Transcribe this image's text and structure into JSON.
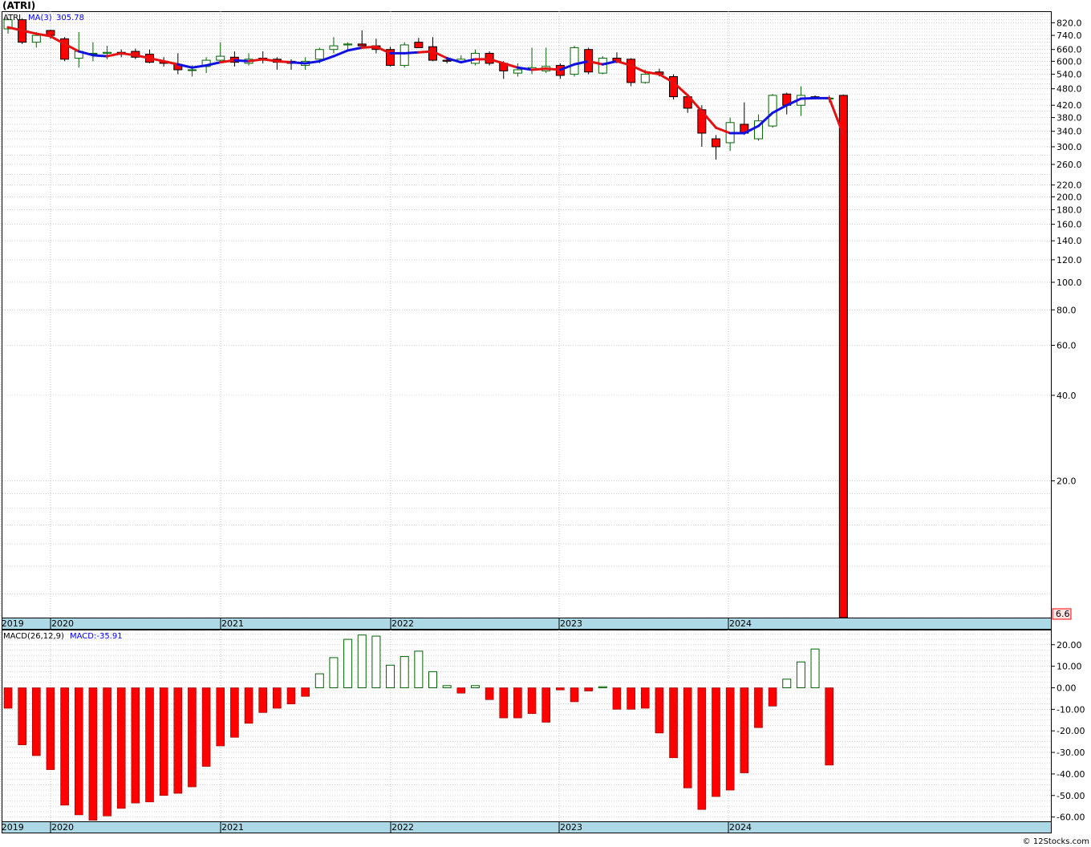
{
  "title": "(ATRI)",
  "copyright": "© 12Stocks.com",
  "colors": {
    "up": "#006400",
    "down": "#ff0000",
    "ma_down": "#e61010",
    "ma_up": "#1010e0",
    "axis_band": "#add8e6",
    "grid": "#b4b4b4",
    "last_price_bg": "#ffe4e1"
  },
  "chart_data": [
    {
      "type": "candlestick",
      "panel": "price",
      "legend": {
        "symbol": "ATRI",
        "ma_label": "MA(3)",
        "ma_value": "305.78"
      },
      "y_scale": "log",
      "ylim": [
        6.6,
        900
      ],
      "y_ticks": [
        "820.0",
        "740.0",
        "660.0",
        "600.0",
        "540.0",
        "480.0",
        "420.0",
        "380.0",
        "340.0",
        "300.0",
        "260.0",
        "220.0",
        "200.0",
        "180.0",
        "160.0",
        "140.0",
        "120.0",
        "100.0",
        "80.0",
        "60.0",
        "40.0",
        "20.0"
      ],
      "last_price": "6.6",
      "x_labels": [
        "2019",
        "2020",
        "2021",
        "2022",
        "2023",
        "2024"
      ],
      "candles": [
        {
          "o": 780,
          "h": 850,
          "l": 750,
          "c": 840
        },
        {
          "o": 840,
          "h": 850,
          "l": 690,
          "c": 700
        },
        {
          "o": 700,
          "h": 760,
          "l": 670,
          "c": 740
        },
        {
          "o": 770,
          "h": 775,
          "l": 720,
          "c": 740
        },
        {
          "o": 720,
          "h": 730,
          "l": 600,
          "c": 610
        },
        {
          "o": 615,
          "h": 760,
          "l": 570,
          "c": 650
        },
        {
          "o": 640,
          "h": 700,
          "l": 600,
          "c": 640
        },
        {
          "o": 640,
          "h": 680,
          "l": 610,
          "c": 645
        },
        {
          "o": 645,
          "h": 660,
          "l": 620,
          "c": 635
        },
        {
          "o": 650,
          "h": 665,
          "l": 610,
          "c": 620
        },
        {
          "o": 635,
          "h": 660,
          "l": 590,
          "c": 595
        },
        {
          "o": 600,
          "h": 620,
          "l": 575,
          "c": 590
        },
        {
          "o": 585,
          "h": 640,
          "l": 540,
          "c": 560
        },
        {
          "o": 560,
          "h": 580,
          "l": 530,
          "c": 560
        },
        {
          "o": 575,
          "h": 620,
          "l": 545,
          "c": 605
        },
        {
          "o": 605,
          "h": 700,
          "l": 590,
          "c": 625
        },
        {
          "o": 620,
          "h": 650,
          "l": 575,
          "c": 595
        },
        {
          "o": 590,
          "h": 640,
          "l": 580,
          "c": 610
        },
        {
          "o": 615,
          "h": 650,
          "l": 590,
          "c": 605
        },
        {
          "o": 610,
          "h": 620,
          "l": 560,
          "c": 595
        },
        {
          "o": 600,
          "h": 610,
          "l": 560,
          "c": 590
        },
        {
          "o": 580,
          "h": 620,
          "l": 560,
          "c": 600
        },
        {
          "o": 610,
          "h": 670,
          "l": 590,
          "c": 660
        },
        {
          "o": 660,
          "h": 730,
          "l": 640,
          "c": 680
        },
        {
          "o": 685,
          "h": 700,
          "l": 650,
          "c": 690
        },
        {
          "o": 690,
          "h": 770,
          "l": 680,
          "c": 680
        },
        {
          "o": 680,
          "h": 720,
          "l": 640,
          "c": 660
        },
        {
          "o": 660,
          "h": 675,
          "l": 575,
          "c": 580
        },
        {
          "o": 580,
          "h": 700,
          "l": 570,
          "c": 685
        },
        {
          "o": 700,
          "h": 725,
          "l": 690,
          "c": 670
        },
        {
          "o": 675,
          "h": 730,
          "l": 600,
          "c": 605
        },
        {
          "o": 605,
          "h": 620,
          "l": 590,
          "c": 600
        },
        {
          "o": 600,
          "h": 630,
          "l": 590,
          "c": 610
        },
        {
          "o": 590,
          "h": 660,
          "l": 580,
          "c": 640
        },
        {
          "o": 640,
          "h": 650,
          "l": 580,
          "c": 590
        },
        {
          "o": 590,
          "h": 600,
          "l": 520,
          "c": 555
        },
        {
          "o": 545,
          "h": 590,
          "l": 530,
          "c": 560
        },
        {
          "o": 560,
          "h": 670,
          "l": 540,
          "c": 570
        },
        {
          "o": 555,
          "h": 670,
          "l": 545,
          "c": 575
        },
        {
          "o": 580,
          "h": 590,
          "l": 520,
          "c": 535
        },
        {
          "o": 540,
          "h": 680,
          "l": 530,
          "c": 670
        },
        {
          "o": 660,
          "h": 670,
          "l": 540,
          "c": 550
        },
        {
          "o": 545,
          "h": 625,
          "l": 540,
          "c": 615
        },
        {
          "o": 615,
          "h": 645,
          "l": 590,
          "c": 600
        },
        {
          "o": 610,
          "h": 615,
          "l": 490,
          "c": 505
        },
        {
          "o": 505,
          "h": 560,
          "l": 500,
          "c": 540
        },
        {
          "o": 550,
          "h": 565,
          "l": 530,
          "c": 540
        },
        {
          "o": 530,
          "h": 540,
          "l": 440,
          "c": 450
        },
        {
          "o": 450,
          "h": 460,
          "l": 395,
          "c": 410
        },
        {
          "o": 405,
          "h": 420,
          "l": 300,
          "c": 335
        },
        {
          "o": 320,
          "h": 330,
          "l": 270,
          "c": 300
        },
        {
          "o": 310,
          "h": 380,
          "l": 290,
          "c": 365
        },
        {
          "o": 360,
          "h": 430,
          "l": 330,
          "c": 335
        },
        {
          "o": 320,
          "h": 390,
          "l": 315,
          "c": 370
        },
        {
          "o": 355,
          "h": 460,
          "l": 350,
          "c": 455
        },
        {
          "o": 460,
          "h": 465,
          "l": 390,
          "c": 420
        },
        {
          "o": 420,
          "h": 490,
          "l": 385,
          "c": 455
        },
        {
          "o": 450,
          "h": 455,
          "l": 440,
          "c": 445
        },
        {
          "o": 445,
          "h": 455,
          "l": 430,
          "c": 445
        },
        {
          "o": 455,
          "h": 458,
          "l": 6.4,
          "c": 6.6
        }
      ],
      "ma": [
        790,
        770,
        750,
        735,
        690,
        650,
        630,
        625,
        640,
        630,
        615,
        600,
        585,
        570,
        580,
        595,
        605,
        600,
        610,
        600,
        595,
        590,
        600,
        625,
        655,
        670,
        675,
        640,
        640,
        645,
        650,
        615,
        595,
        610,
        610,
        590,
        570,
        560,
        565,
        560,
        585,
        600,
        585,
        600,
        580,
        550,
        540,
        505,
        455,
        400,
        350,
        335,
        335,
        355,
        395,
        420,
        443,
        445,
        445,
        330
      ],
      "ma_colors": [
        "down",
        "down",
        "down",
        "down",
        "down",
        "down",
        "up",
        "up",
        "down",
        "down",
        "down",
        "down",
        "down",
        "up",
        "up",
        "up",
        "down",
        "up",
        "down",
        "down",
        "down",
        "up",
        "up",
        "up",
        "up",
        "up",
        "down",
        "down",
        "up",
        "up",
        "down",
        "down",
        "up",
        "up",
        "down",
        "down",
        "down",
        "up",
        "down",
        "down",
        "up",
        "up",
        "down",
        "up",
        "down",
        "down",
        "down",
        "down",
        "down",
        "down",
        "down",
        "down",
        "up",
        "up",
        "up",
        "up",
        "up",
        "up",
        "up",
        "down"
      ]
    },
    {
      "type": "bar",
      "panel": "macd",
      "legend": {
        "label": "MACD(26,12,9)",
        "value_label": "MACD:-35.91"
      },
      "ylim": [
        -62,
        27
      ],
      "y_ticks": [
        "20.00",
        "10.00",
        "0.00",
        "-10.00",
        "-20.00",
        "-30.00",
        "-40.00",
        "-50.00",
        "-60.00"
      ],
      "x_labels": [
        "2019",
        "2020",
        "2021",
        "2022",
        "2023",
        "2024"
      ],
      "values": [
        -9.5,
        -26.5,
        -31.5,
        -38.0,
        -54.5,
        -59.0,
        -61.5,
        -59.5,
        -56.0,
        -53.5,
        -53.0,
        -50.0,
        -49.0,
        -46.0,
        -36.5,
        -27.0,
        -23.0,
        -16.5,
        -11.5,
        -9.5,
        -7.5,
        -4.0,
        6.5,
        14.0,
        22.5,
        24.5,
        24.0,
        10.5,
        14.5,
        17.0,
        7.5,
        1.0,
        -2.5,
        1.0,
        -5.5,
        -14.0,
        -14.0,
        -12.0,
        -16.0,
        -1.0,
        -6.5,
        -1.5,
        0.5,
        -10.0,
        -10.0,
        -9.5,
        -21.0,
        -32.5,
        -46.5,
        -56.5,
        -50.5,
        -47.5,
        -39.5,
        -18.5,
        -8.5,
        4.0,
        12.0,
        18.0,
        -35.91
      ]
    }
  ]
}
